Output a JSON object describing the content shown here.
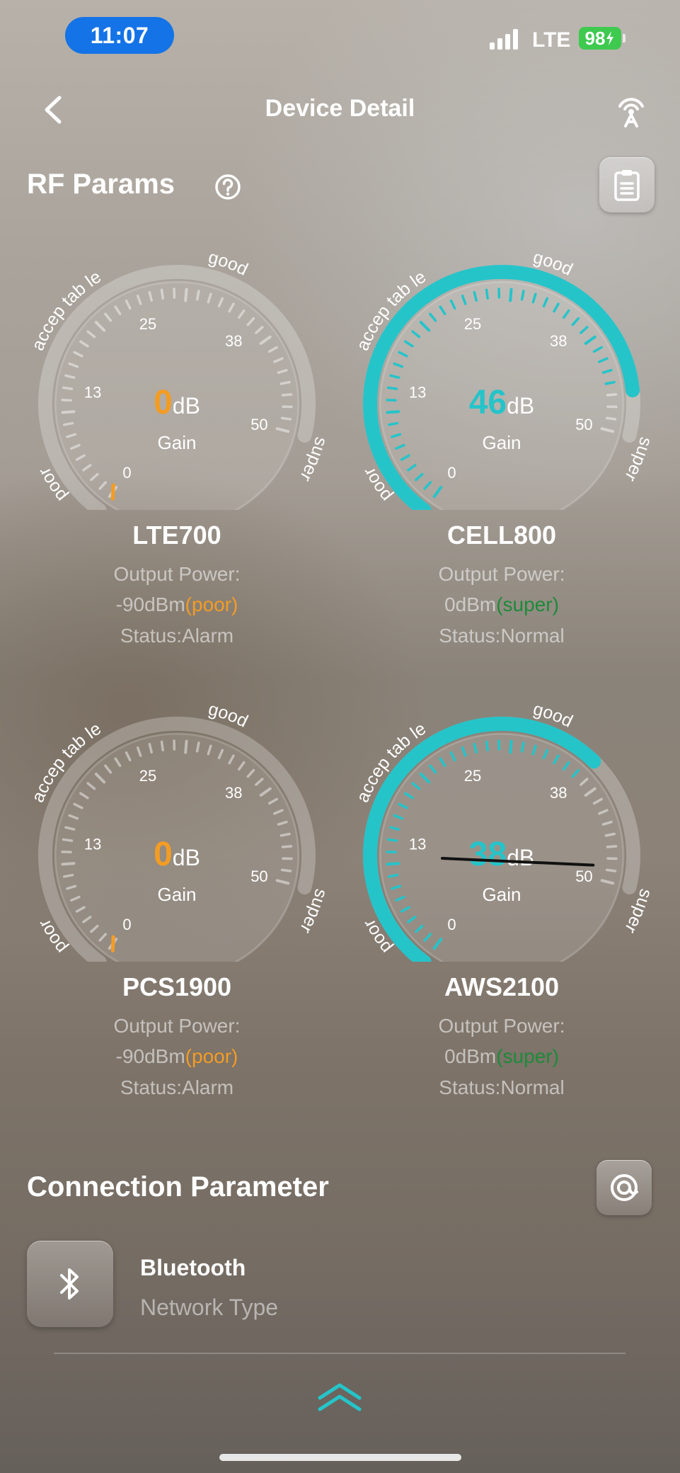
{
  "status_bar": {
    "time": "11:07",
    "network": "LTE",
    "battery": "98"
  },
  "nav": {
    "title": "Device Detail",
    "back_icon": "chevron-left-icon",
    "action_icon": "antenna-icon"
  },
  "rf": {
    "title": "RF Params",
    "help_icon": "question-circle-icon",
    "report_icon": "clipboard-icon",
    "gauge_labels": {
      "poor": "poor",
      "acceptable": "accep tab le",
      "good": "good",
      "super": "super",
      "unit": "dB",
      "gain_label": "Gain"
    },
    "scale": [
      "0",
      "13",
      "25",
      "38",
      "50"
    ],
    "accent_color": "#25c4c9",
    "poor_color": "#f39c24",
    "super_color": "#1e8a3a",
    "bands": [
      {
        "name": "LTE700",
        "gain": "0",
        "gain_value": 0,
        "power_label": "Output Power:",
        "power": "-90dBm",
        "level": "(poor)",
        "level_class": "poor",
        "status": "Status:Alarm"
      },
      {
        "name": "CELL800",
        "gain": "46",
        "gain_value": 46,
        "power_label": "Output Power:",
        "power": "0dBm",
        "level": "(super)",
        "level_class": "super",
        "status": "Status:Normal"
      },
      {
        "name": "PCS1900",
        "gain": "0",
        "gain_value": 0,
        "power_label": "Output Power:",
        "power": "-90dBm",
        "level": "(poor)",
        "level_class": "poor",
        "status": "Status:Alarm"
      },
      {
        "name": "AWS2100",
        "gain": "38",
        "gain_value": 38,
        "power_label": "Output Power:",
        "power": "0dBm",
        "level": "(super)",
        "level_class": "super",
        "status": "Status:Normal"
      }
    ]
  },
  "connection": {
    "title": "Connection Parameter",
    "settings_icon": "target-icon",
    "item": {
      "icon": "bluetooth-icon",
      "value": "Bluetooth",
      "label": "Network Type"
    },
    "expand_icon": "double-chevron-up-icon"
  }
}
